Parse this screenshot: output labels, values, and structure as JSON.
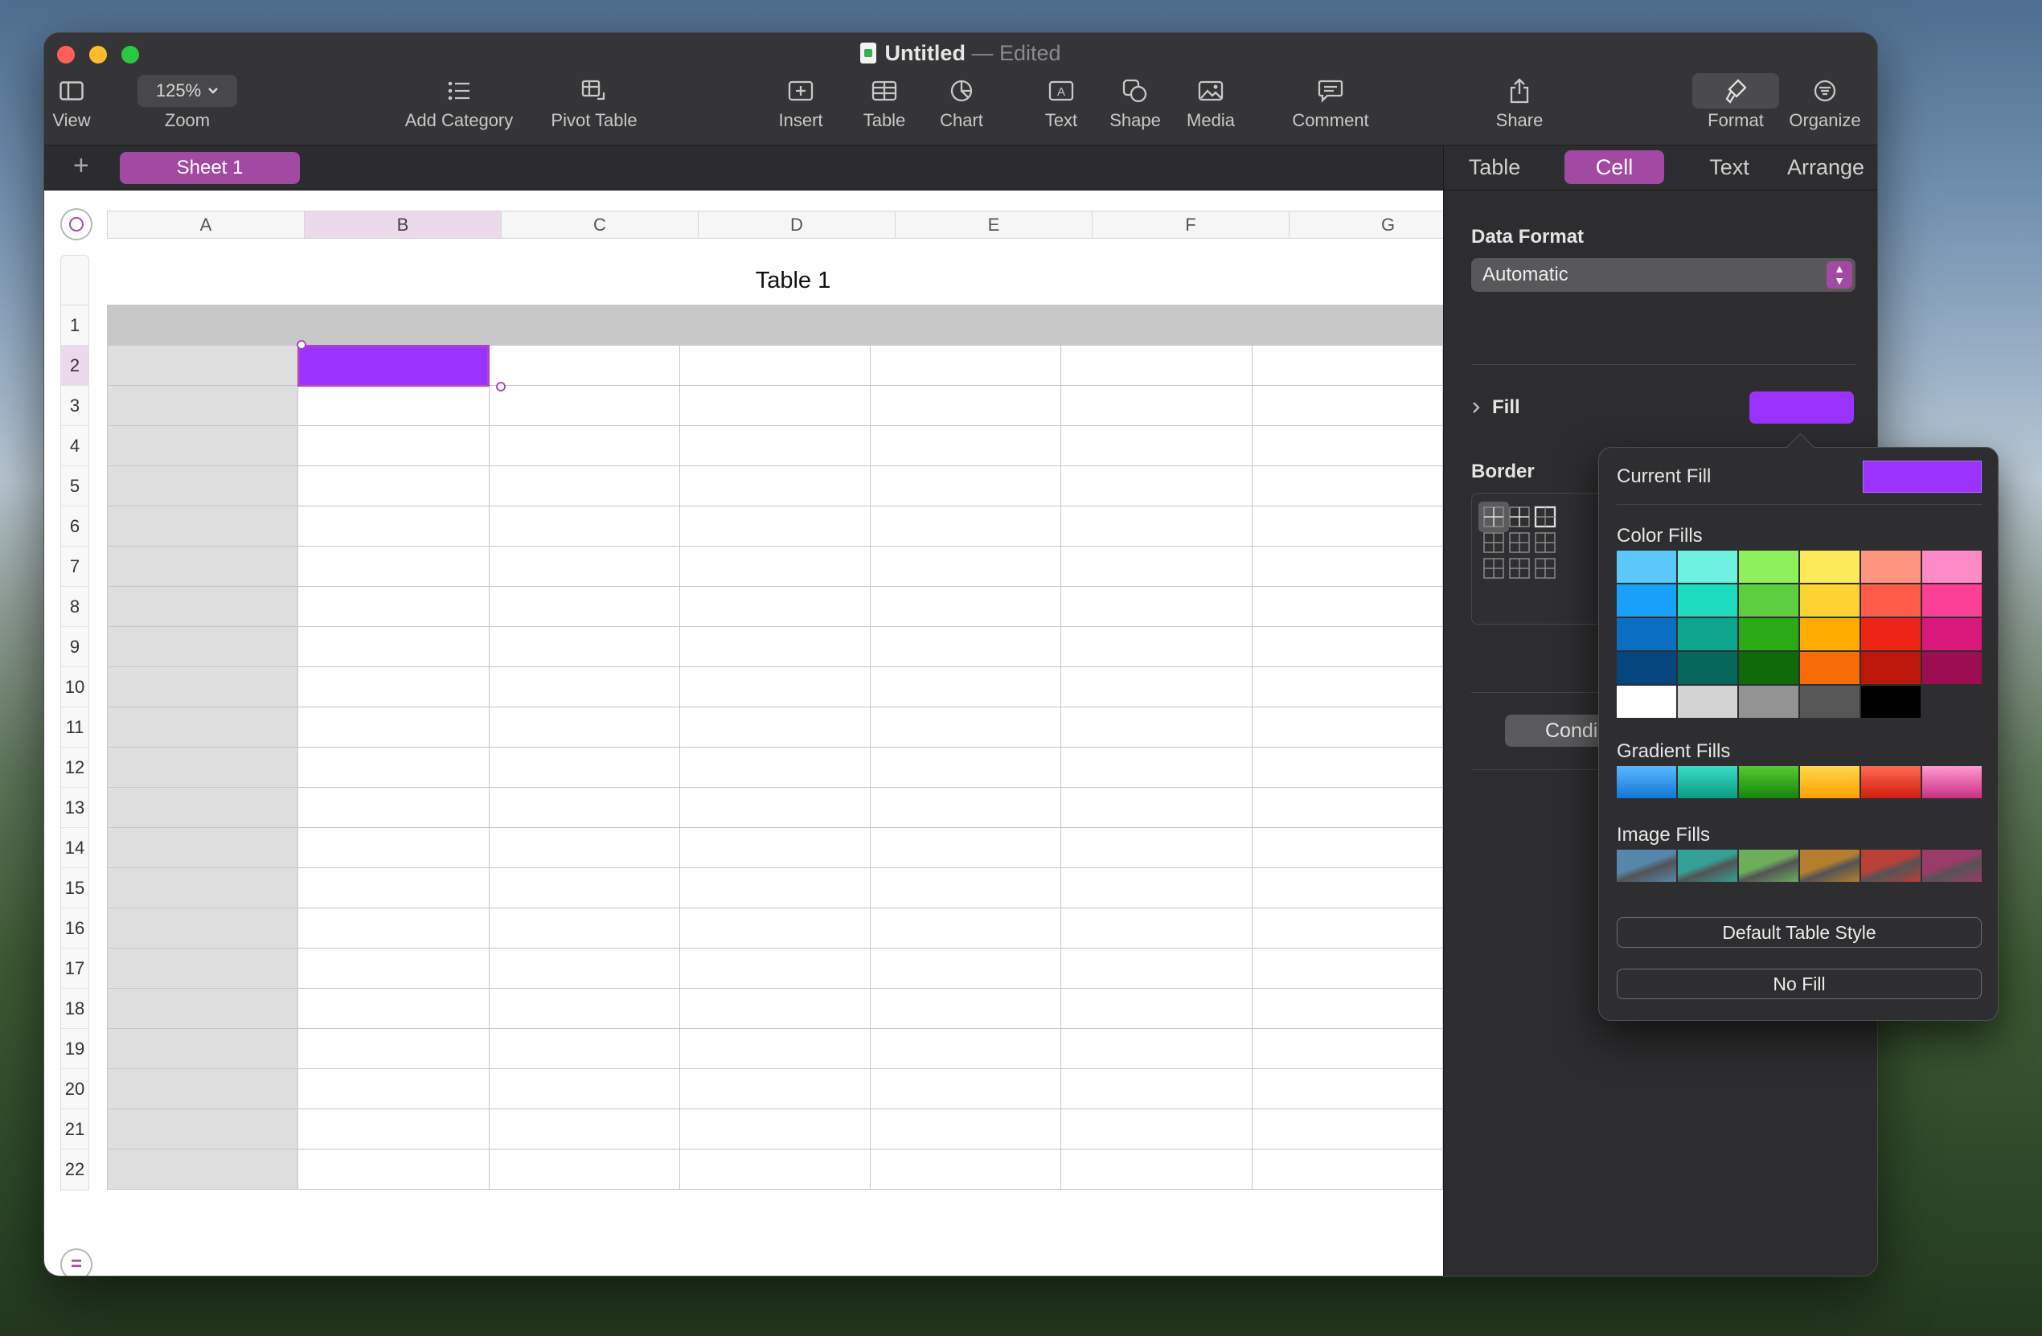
{
  "window": {
    "doc_name": "Untitled",
    "separator": "—",
    "status": "Edited"
  },
  "toolbar": {
    "view": "View",
    "zoom_value": "125%",
    "zoom": "Zoom",
    "add_category": "Add Category",
    "pivot_table": "Pivot Table",
    "insert": "Insert",
    "table": "Table",
    "chart": "Chart",
    "text": "Text",
    "shape": "Shape",
    "media": "Media",
    "comment": "Comment",
    "share": "Share",
    "format": "Format",
    "organize": "Organize"
  },
  "sheets": {
    "add": "+",
    "active": "Sheet 1"
  },
  "spreadsheet": {
    "table_title": "Table 1",
    "columns": [
      "A",
      "B",
      "C",
      "D",
      "E",
      "F",
      "G"
    ],
    "selected_column": "B",
    "rows": [
      "1",
      "2",
      "3",
      "4",
      "5",
      "6",
      "7",
      "8",
      "9",
      "10",
      "11",
      "12",
      "13",
      "14",
      "15",
      "16",
      "17",
      "18",
      "19",
      "20",
      "21",
      "22"
    ],
    "selected_row": "2",
    "selected_cell_fill": "#9b32ff"
  },
  "inspector": {
    "tabs": [
      "Table",
      "Cell",
      "Text",
      "Arrange"
    ],
    "active_tab": "Cell",
    "data_format_label": "Data Format",
    "data_format_value": "Automatic",
    "fill_label": "Fill",
    "fill_color": "#9b32ff",
    "border_label": "Border",
    "conditional_button": "Condi"
  },
  "fill_popover": {
    "current_fill_label": "Current Fill",
    "current_fill_color": "#9b32ff",
    "color_fills_label": "Color Fills",
    "color_fills": [
      [
        "#5ac8fa",
        "#6ef0e0",
        "#8ef05a",
        "#fcea58",
        "#ff9580",
        "#ff8ac8"
      ],
      [
        "#18a0fb",
        "#1ddbbf",
        "#5ccd3c",
        "#fdd233",
        "#ff5a47",
        "#fb3e96"
      ],
      [
        "#0a6fc0",
        "#0ea58e",
        "#2aaa16",
        "#ffab00",
        "#ee2416",
        "#d8187a"
      ],
      [
        "#05467f",
        "#06685d",
        "#0f6a09",
        "#f76c07",
        "#bd160b",
        "#9c0d52"
      ],
      [
        "#ffffff",
        "#d3d3d3",
        "#939393",
        "#575757",
        "#000000",
        ""
      ]
    ],
    "gradient_fills_label": "Gradient Fills",
    "gradient_fills": [
      [
        "#5bb8ff",
        "#1278d6"
      ],
      [
        "#3bdcc4",
        "#0a9c85"
      ],
      [
        "#56cb32",
        "#17850b"
      ],
      [
        "#ffd84a",
        "#ff9f00"
      ],
      [
        "#ff6a50",
        "#d31d12"
      ],
      [
        "#ff9ad0",
        "#c92f83"
      ]
    ],
    "image_fills_label": "Image Fills",
    "image_fills": [
      "#5587ad",
      "#34a097",
      "#6cae5a",
      "#b57e2e",
      "#b84037",
      "#9b3b6a"
    ],
    "default_table_style_button": "Default Table Style",
    "no_fill_button": "No Fill"
  }
}
